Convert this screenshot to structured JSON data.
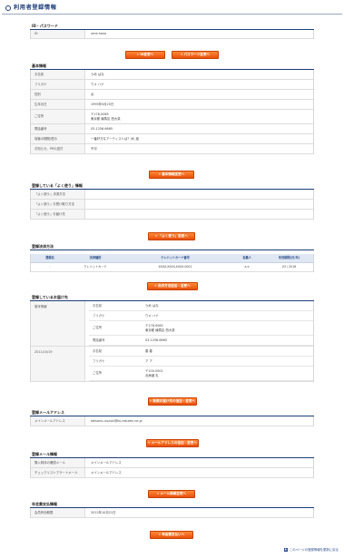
{
  "page": {
    "title": "利用者登録情報"
  },
  "id_password": {
    "title": "ID・パスワード",
    "rows": [
      {
        "label": "ID",
        "value": "ume.hana"
      }
    ],
    "buttons": {
      "change_id": "» ID変更へ",
      "change_password": "» パスワード変更へ"
    }
  },
  "basic_info": {
    "title": "基本情報",
    "rows": [
      {
        "label": "お名前",
        "value": "うめ はな"
      },
      {
        "label": "フリガナ",
        "value": "ウメ ハナ"
      },
      {
        "label": "性別",
        "value": "女"
      },
      {
        "label": "生年月日",
        "value": "1995年5月25日"
      },
      {
        "label": "ご住所",
        "value": "〒178-0065",
        "value2": "東京都 練馬区 西大泉"
      },
      {
        "label": "電話番号",
        "value": "03-1256-6665"
      },
      {
        "label": "保管の期間/提示",
        "value": "一番好きなアーティストは？(6) 嵐"
      },
      {
        "label": "お知らせ、PRの送付",
        "value": "不可"
      }
    ],
    "button": "» 基本情報変更へ"
  },
  "often_use": {
    "title": "登録している「よく使う」情報",
    "rows": [
      {
        "label": "「よく使う」決済方法",
        "value": ""
      },
      {
        "label": "「よく使う」お受け取り方法",
        "value": ""
      },
      {
        "label": "「よく使う」お届け先",
        "value": ""
      }
    ],
    "button": "» 「よく使う」設定へ"
  },
  "payment": {
    "title": "登録決済方法",
    "headers": [
      "登録名",
      "決済種別",
      "クレジットカード番号",
      "名義人",
      "有効期限(月/年)"
    ],
    "rows": [
      [
        "-",
        "クレジットカード",
        "XXXX-XXXX-XXXX-0002",
        "a a",
        "03 / 2016"
      ]
    ],
    "button": "» 決済方法追加・変更へ"
  },
  "delivery": {
    "title": "登録しているお届け先",
    "groups": [
      {
        "label": "基本情報",
        "rows": [
          {
            "key": "お名前",
            "value": "うめ はな"
          },
          {
            "key": "フリガナ",
            "value": "ウメ ハナ"
          },
          {
            "key": "ご住所",
            "value": "〒178-0065",
            "value2": "東京都 練馬区 西大泉"
          },
          {
            "key": "電話番号",
            "value": "03-1256-6665"
          }
        ]
      },
      {
        "label": "2011/10/19",
        "rows": [
          {
            "key": "お名前",
            "value": "春 春"
          },
          {
            "key": "フリガナ",
            "value": "ア ア"
          },
          {
            "key": "ご住所",
            "value": "〒100-0001",
            "value2": "北海道 札"
          }
        ]
      }
    ],
    "button": "» 新規お届け先の追加・変更へ"
  },
  "mail_address": {
    "title": "登録メールアドレス",
    "rows": [
      {
        "label": "メインメールアドレス",
        "value": "ebisonic-suzuki@ks.rakuten.ne.jp"
      }
    ],
    "button": "» メールアドレスの追加・変更へ"
  },
  "mail_settings": {
    "title": "登録メール情報",
    "rows": [
      {
        "label": "購入時待の確認メール",
        "value": "メインメールアドレス"
      },
      {
        "label": "チェックリストアラートメール",
        "value": "メインメールアドレス"
      }
    ],
    "button": "» メール情報変更へ"
  },
  "annual_fee": {
    "title": "年会費支払情報",
    "rows": [
      {
        "label": "会員有効期限",
        "value": "2012年10月21日"
      }
    ],
    "button": "» 年会費支払いへ"
  },
  "footer": {
    "link": "このページの登録情報を更新に戻る"
  },
  "colors": {
    "navy": "#1d3d7a",
    "orange": "#f26a1b"
  }
}
